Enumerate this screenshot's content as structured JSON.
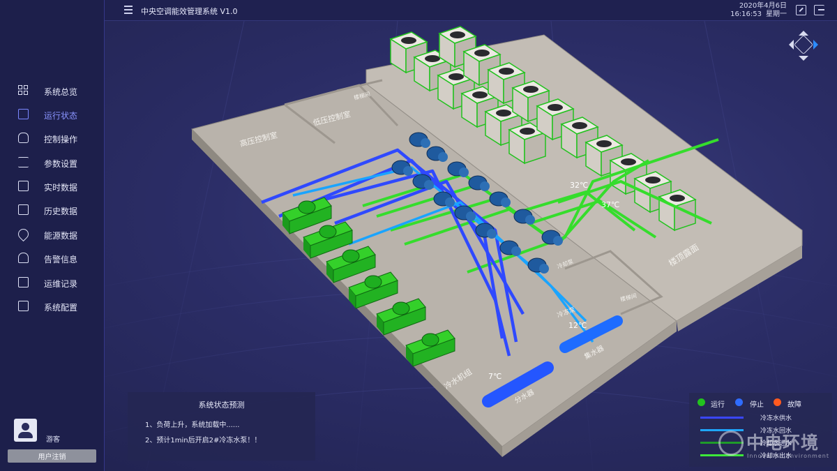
{
  "header": {
    "title": "中央空调能效管理系统 V1.0",
    "date": "2020年4月6日",
    "time": "16:16:53",
    "weekday": "星期一"
  },
  "sidebar": {
    "items": [
      {
        "label": "系统总览",
        "icon": "grid-icon"
      },
      {
        "label": "运行状态",
        "icon": "monitor-check-icon"
      },
      {
        "label": "控制操作",
        "icon": "hand-pointer-icon"
      },
      {
        "label": "参数设置",
        "icon": "sliders-icon"
      },
      {
        "label": "实时数据",
        "icon": "chart-bars-icon"
      },
      {
        "label": "历史数据",
        "icon": "calendar-icon"
      },
      {
        "label": "能源数据",
        "icon": "energy-drop-icon"
      },
      {
        "label": "告警信息",
        "icon": "bell-icon"
      },
      {
        "label": "运维记录",
        "icon": "edit-log-icon"
      },
      {
        "label": "系统配置",
        "icon": "settings-screen-icon"
      }
    ],
    "active_index": 1,
    "user": {
      "name": "游客",
      "logout_label": "用户注销"
    }
  },
  "scene": {
    "room_labels": {
      "hv_room": "高压控制室",
      "lv_room": "低压控制室",
      "stair_top": "楼梯间",
      "stair_bottom": "楼梯间",
      "roof": "楼顶露面",
      "chiller_group": "冷水机组",
      "cooling_pump": "冷却泵",
      "chilled_pump": "冷冻泵",
      "collector": "集水器",
      "distributor": "分水器"
    },
    "temps": {
      "cooling_in": "32℃",
      "cooling_out": "37℃",
      "chilled_return": "12℃",
      "chilled_supply": "7℃"
    },
    "colors": {
      "equipment_running": "#22c21e",
      "pipe_chilled_supply": "#2f49ff",
      "pipe_chilled_return": "#1aa4ff",
      "pipe_cooling": "#35dd2c",
      "floor": "#b7b1a9"
    }
  },
  "prediction": {
    "title": "系统状态预测",
    "lines": [
      "1、负荷上升，系统加载中......",
      "2、预计1min后开启2#冷冻水泵！！"
    ]
  },
  "legend": {
    "status": [
      {
        "label": "运行",
        "color": "#22c21e"
      },
      {
        "label": "停止",
        "color": "#2f6cff"
      },
      {
        "label": "故障",
        "color": "#ff5a1f"
      }
    ],
    "pipes": [
      {
        "label": "冷冻水供水",
        "color": "#3a46ff"
      },
      {
        "label": "冷冻水回水",
        "color": "#1ea6ff"
      },
      {
        "label": "冷却水进水",
        "color": "#1f9a2a"
      },
      {
        "label": "冷却水出水",
        "color": "#3de83a"
      }
    ]
  },
  "watermark": {
    "cn": "中电环境",
    "en": "Innovation  Environment"
  }
}
